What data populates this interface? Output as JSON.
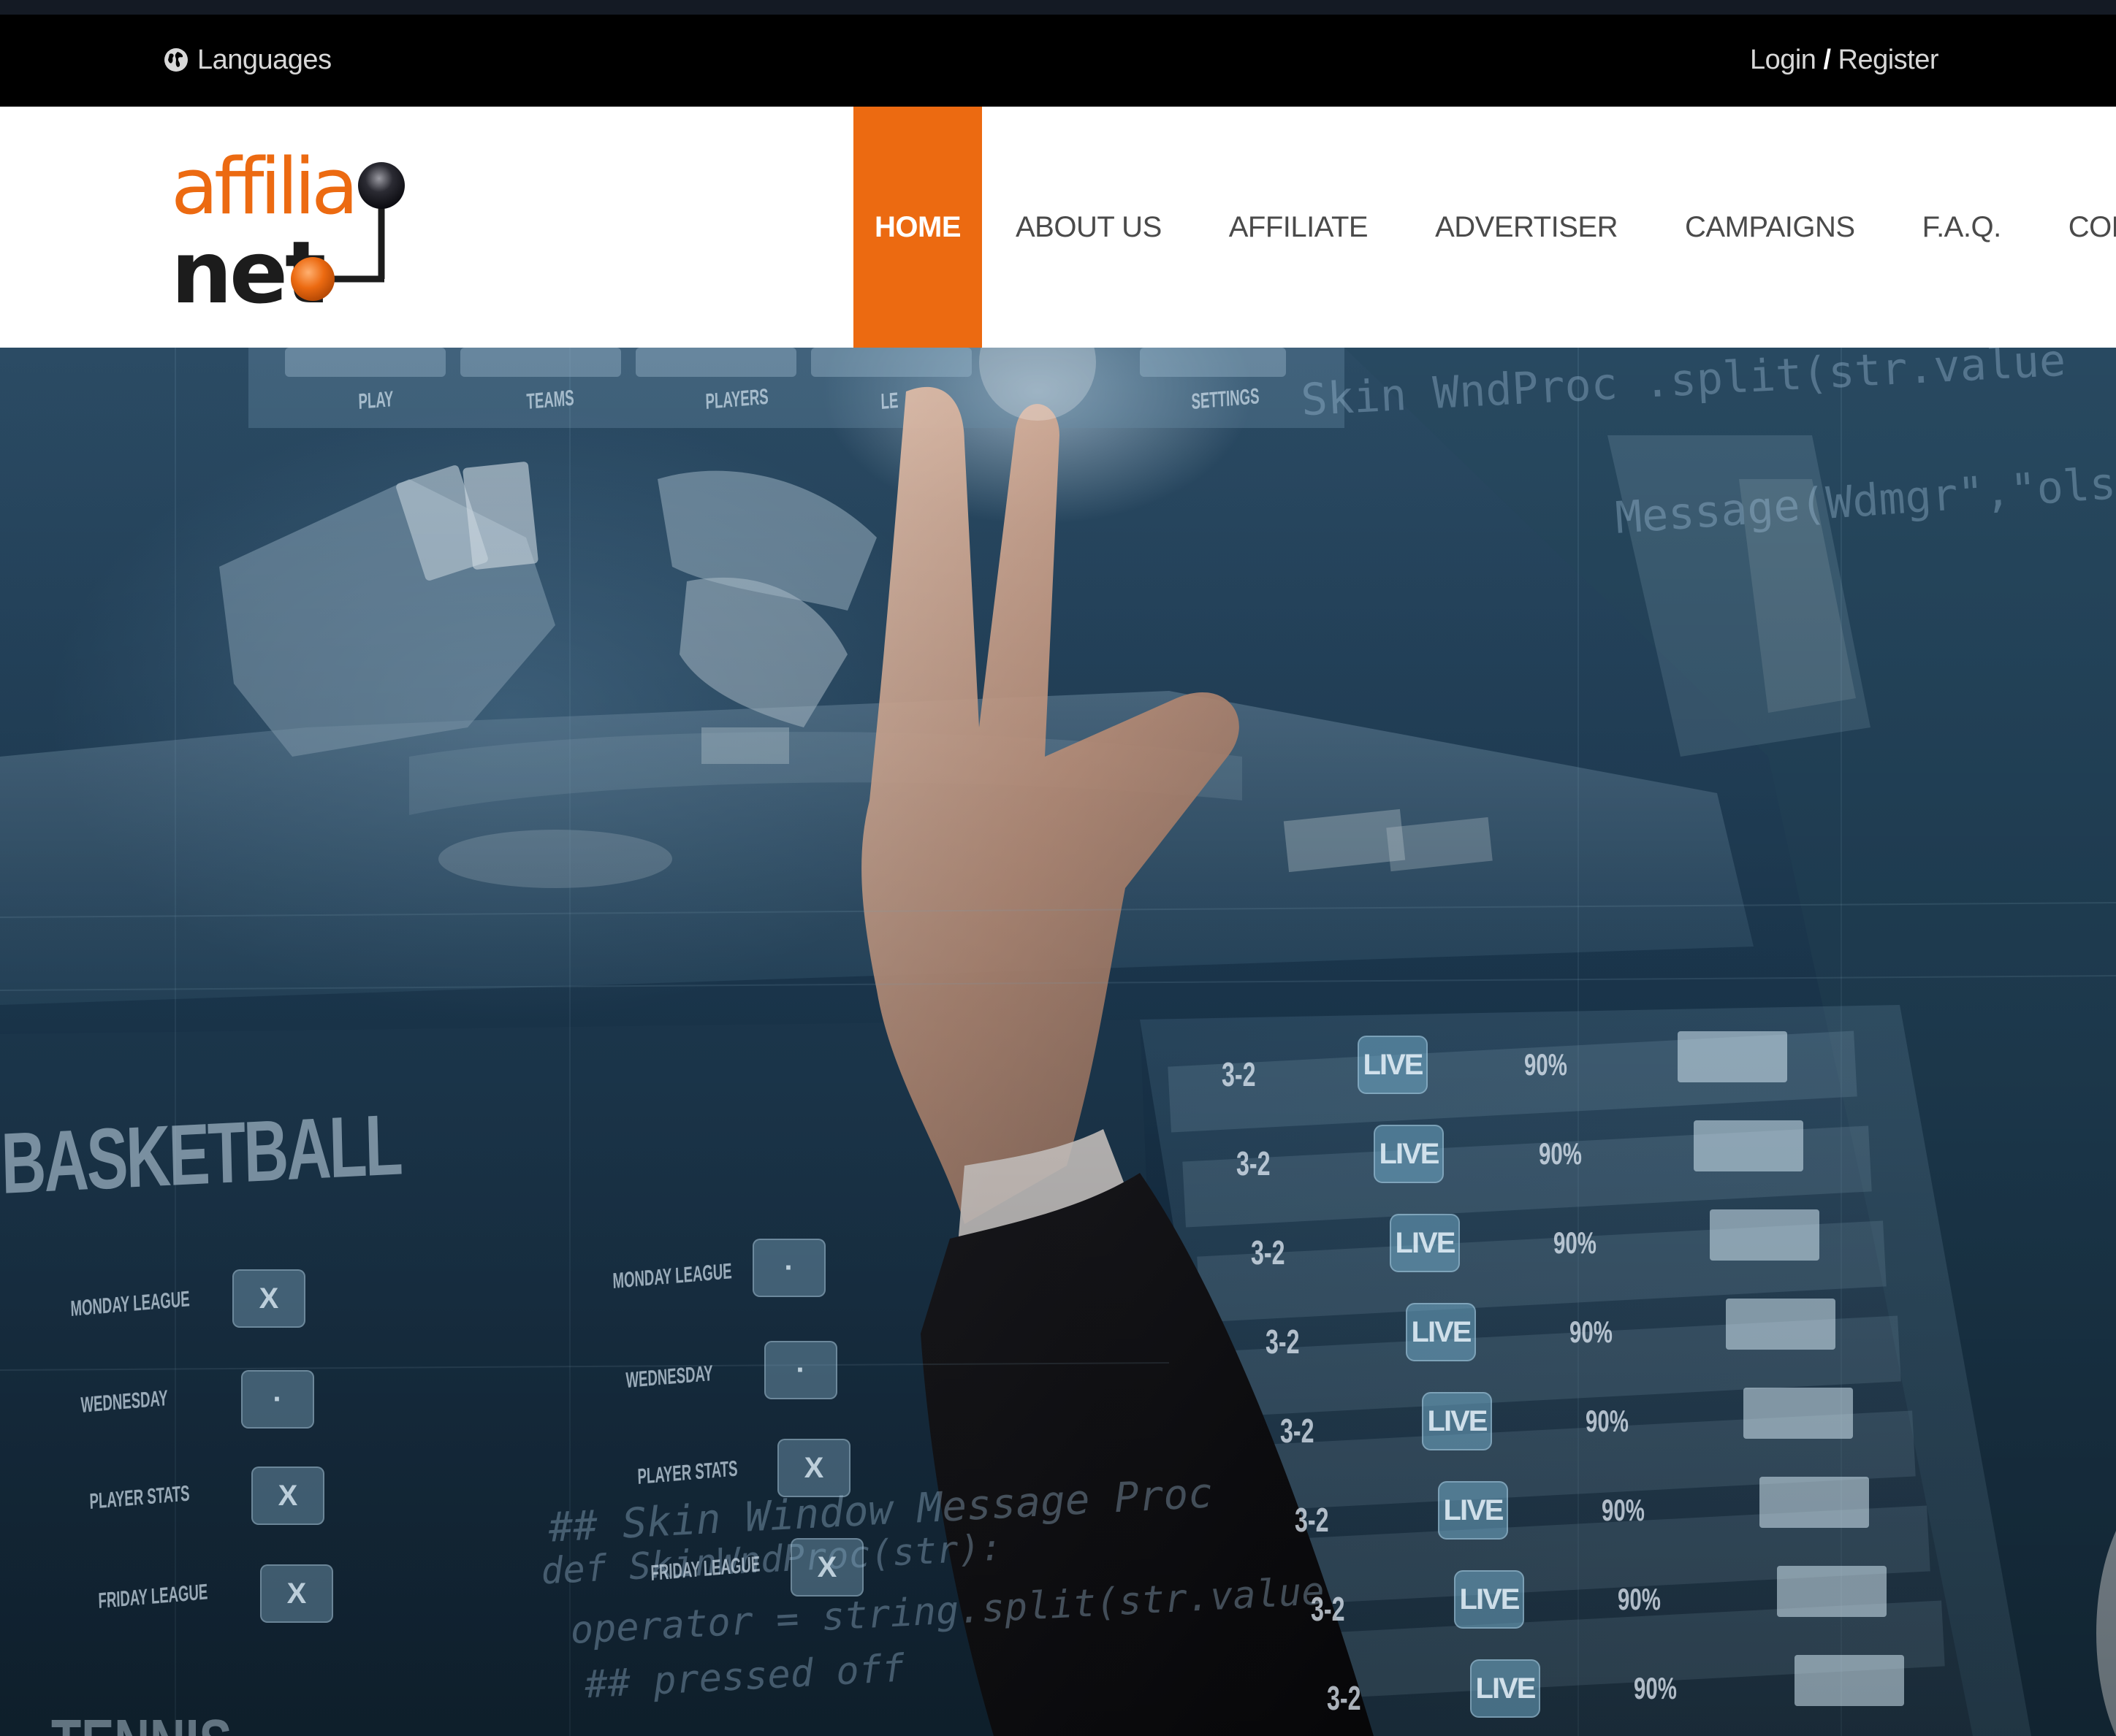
{
  "utility_bar": {
    "languages_label": "Languages",
    "login_label": "Login",
    "separator": "/",
    "register_label": "Register"
  },
  "brand": {
    "logo_line1": "affilia",
    "logo_line2": "net",
    "accent_color": "#ec6a11",
    "text_color": "#1c1c1c"
  },
  "nav": {
    "items": [
      {
        "label": "HOME",
        "active": true
      },
      {
        "label": "ABOUT US",
        "active": false
      },
      {
        "label": "AFFILIATE",
        "active": false
      },
      {
        "label": "ADVERTISER",
        "active": false
      },
      {
        "label": "CAMPAIGNS",
        "active": false
      },
      {
        "label": "F.A.Q.",
        "active": false
      },
      {
        "label": "CONTACT",
        "active": false
      }
    ]
  },
  "hero": {
    "screen_title": "BASKETBALL",
    "screen_subtitle": "TENNIS",
    "left_rows": [
      {
        "label": "MONDAY LEAGUE",
        "chip": "X"
      },
      {
        "label": "WEDNESDAY",
        "chip": "·"
      },
      {
        "label": "PLAYER STATS",
        "chip": "X"
      },
      {
        "label": "FRIDAY LEAGUE",
        "chip": "X"
      }
    ],
    "mid_rows": [
      {
        "label": "MONDAY LEAGUE",
        "chip": "·"
      },
      {
        "label": "WEDNESDAY",
        "chip": "·"
      },
      {
        "label": "PLAYER STATS",
        "chip": "X"
      },
      {
        "label": "FRIDAY LEAGUE",
        "chip": "X"
      }
    ],
    "score_rows": [
      {
        "score": "3-2",
        "badge": "LIVE",
        "pct": "90%"
      },
      {
        "score": "3-2",
        "badge": "LIVE",
        "pct": "90%"
      },
      {
        "score": "3-2",
        "badge": "LIVE",
        "pct": "90%"
      },
      {
        "score": "3-2",
        "badge": "LIVE",
        "pct": "90%"
      },
      {
        "score": "3-2",
        "badge": "LIVE",
        "pct": "90%"
      },
      {
        "score": "3-2",
        "badge": "LIVE",
        "pct": "90%"
      },
      {
        "score": "3-2",
        "badge": "LIVE",
        "pct": "90%"
      },
      {
        "score": "3-2",
        "badge": "LIVE",
        "pct": "90%"
      }
    ],
    "top_panel_tabs": [
      "PLAY",
      "TEAMS",
      "PLAYERS",
      "LE",
      "SETTINGS"
    ],
    "code_lines": [
      "## Skin Window Message Proc",
      "def SkinWndProc(str):",
      "operator = string.split(str.value",
      "## pressed off",
      "Skin WndProc .split(str.value",
      "Message(Wdmgr\",\"ols\",\"h"
    ]
  }
}
